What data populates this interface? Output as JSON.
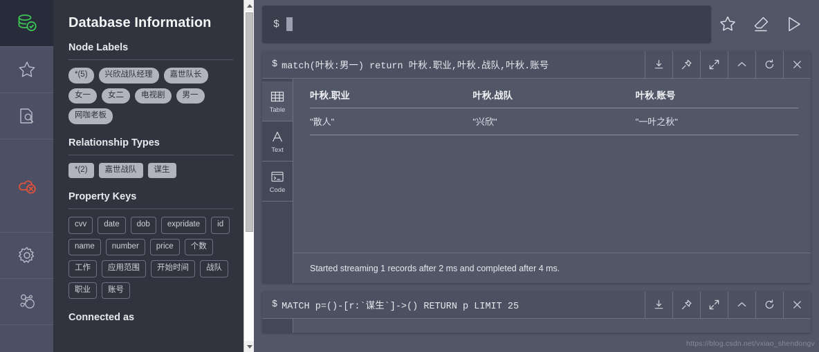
{
  "rail": {
    "items": [
      {
        "name": "database-status-icon",
        "label": "Database connected"
      },
      {
        "name": "favorites-icon",
        "label": "Favorites"
      },
      {
        "name": "documents-icon",
        "label": "Documents"
      },
      {
        "name": "cloud-disconnected-icon",
        "label": "Disconnected"
      },
      {
        "name": "settings-gear-icon",
        "label": "Settings"
      },
      {
        "name": "about-graph-icon",
        "label": "About"
      }
    ],
    "accent_green": "#3cc655",
    "accent_red": "#e0523b",
    "icon_color": "#b9bcc8"
  },
  "sidebar": {
    "title": "Database Information",
    "sections": [
      {
        "heading": "Node Labels",
        "kind": "node",
        "chips": [
          "*(5)",
          "兴欣战队经理",
          "嘉世队长",
          "女一",
          "女二",
          "电视剧",
          "男一",
          "网咖老板"
        ]
      },
      {
        "heading": "Relationship Types",
        "kind": "rel",
        "chips": [
          "*(2)",
          "嘉世战队",
          "谋生"
        ]
      },
      {
        "heading": "Property Keys",
        "kind": "prop",
        "chips": [
          "cvv",
          "date",
          "dob",
          "expridate",
          "id",
          "name",
          "number",
          "price",
          "个数",
          "工作",
          "应用范围",
          "开始时间",
          "战队",
          "职业",
          "账号"
        ]
      }
    ],
    "footer_heading": "Connected as"
  },
  "editor": {
    "prompt": "$",
    "value": "",
    "placeholder": "",
    "actions": [
      {
        "name": "favorite-star-icon",
        "label": "Favorite"
      },
      {
        "name": "clear-eraser-icon",
        "label": "Clear"
      },
      {
        "name": "run-play-icon",
        "label": "Run"
      }
    ]
  },
  "frames": [
    {
      "prompt": "$",
      "query": "match(叶秋:男一) return 叶秋.职业,叶秋.战队,叶秋.账号",
      "buttons": [
        {
          "name": "download-icon",
          "label": "Download"
        },
        {
          "name": "pin-icon",
          "label": "Pin"
        },
        {
          "name": "expand-icon",
          "label": "Expand"
        },
        {
          "name": "collapse-chevron-up-icon",
          "label": "Collapse"
        },
        {
          "name": "refresh-icon",
          "label": "Rerun"
        },
        {
          "name": "close-icon",
          "label": "Close"
        }
      ],
      "views": [
        {
          "name": "view-table",
          "label": "Table",
          "active": true
        },
        {
          "name": "view-text",
          "label": "Text",
          "active": false
        },
        {
          "name": "view-code",
          "label": "Code",
          "active": false
        }
      ],
      "table": {
        "columns": [
          "叶秋.职业",
          "叶秋.战队",
          "叶秋.账号"
        ],
        "rows": [
          [
            "\"散人\"",
            "\"兴欣\"",
            "\"一叶之秋\""
          ]
        ]
      },
      "status": "Started streaming 1 records after 2 ms and completed after 4 ms."
    },
    {
      "prompt": "$",
      "query": "MATCH p=()-[r:`谋生`]->() RETURN p LIMIT 25",
      "buttons": [
        {
          "name": "download-icon",
          "label": "Download"
        },
        {
          "name": "pin-icon",
          "label": "Pin"
        },
        {
          "name": "expand-icon",
          "label": "Expand"
        },
        {
          "name": "collapse-chevron-up-icon",
          "label": "Collapse"
        },
        {
          "name": "refresh-icon",
          "label": "Rerun"
        },
        {
          "name": "close-icon",
          "label": "Close"
        }
      ]
    }
  ],
  "watermark": "https://blog.csdn.net/vxiao_shendongv"
}
